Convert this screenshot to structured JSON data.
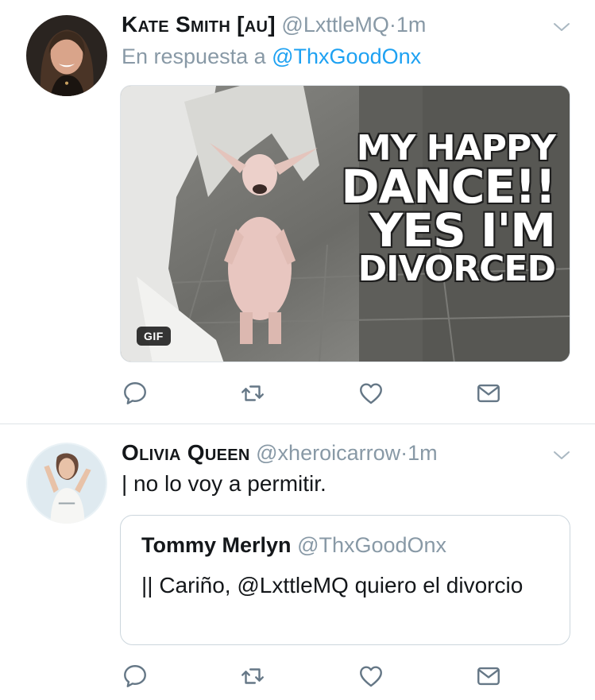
{
  "tweets": [
    {
      "display_name": "Kate Smith [au]",
      "handle": "@LxttleMQ",
      "separator": "·",
      "time": "1m",
      "reply_prefix": "En respuesta a",
      "reply_to": "@ThxGoodOnx",
      "media": {
        "badge": "GIF",
        "caption_lines": [
          "MY HAPPY",
          "DANCE!!",
          "YES I'M",
          "DIVORCED"
        ]
      },
      "actions": [
        "reply-icon",
        "retweet-icon",
        "like-icon",
        "message-icon"
      ]
    },
    {
      "display_name": "Olivia Queen",
      "handle": "@xheroicarrow",
      "separator": "·",
      "time": "1m",
      "text": "| no lo voy a permitir.",
      "quote": {
        "display_name": "Tommy Merlyn",
        "handle": "@ThxGoodOnx",
        "text": "|| Cariño, @LxttleMQ quiero el divorcio"
      },
      "actions": [
        "reply-icon",
        "retweet-icon",
        "like-icon",
        "message-icon"
      ]
    }
  ],
  "colors": {
    "secondary_text": "#8899a6",
    "link": "#1da1f2",
    "border": "#dfe4e8"
  }
}
